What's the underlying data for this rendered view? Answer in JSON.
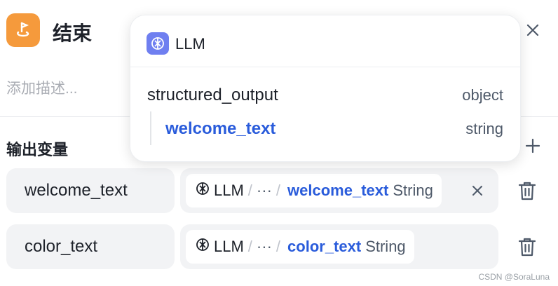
{
  "node": {
    "title": "结束",
    "description_placeholder": "添加描述..."
  },
  "section": {
    "title": "输出变量"
  },
  "outputs": [
    {
      "name": "welcome_text",
      "source_node": "LLM",
      "separator": "/",
      "ellipsis": "···",
      "variable": "welcome_text",
      "type": "String"
    },
    {
      "name": "color_text",
      "source_node": "LLM",
      "separator": "/",
      "ellipsis": "···",
      "variable": "color_text",
      "type": "String"
    }
  ],
  "popover": {
    "node_name": "LLM",
    "items": [
      {
        "name": "structured_output",
        "type": "object"
      },
      {
        "name": "welcome_text",
        "type": "string"
      }
    ]
  },
  "watermark": "CSDN @SoraLuna",
  "colors": {
    "node_icon": "#f59a3c",
    "llm_icon": "#6f7ff0",
    "variable_blue": "#2a5cdb"
  },
  "icons": {
    "node": "flag-pin-icon",
    "close": "close-icon",
    "add": "plus-icon",
    "clear": "clear-icon",
    "delete": "trash-icon",
    "llm": "llm-icon"
  }
}
